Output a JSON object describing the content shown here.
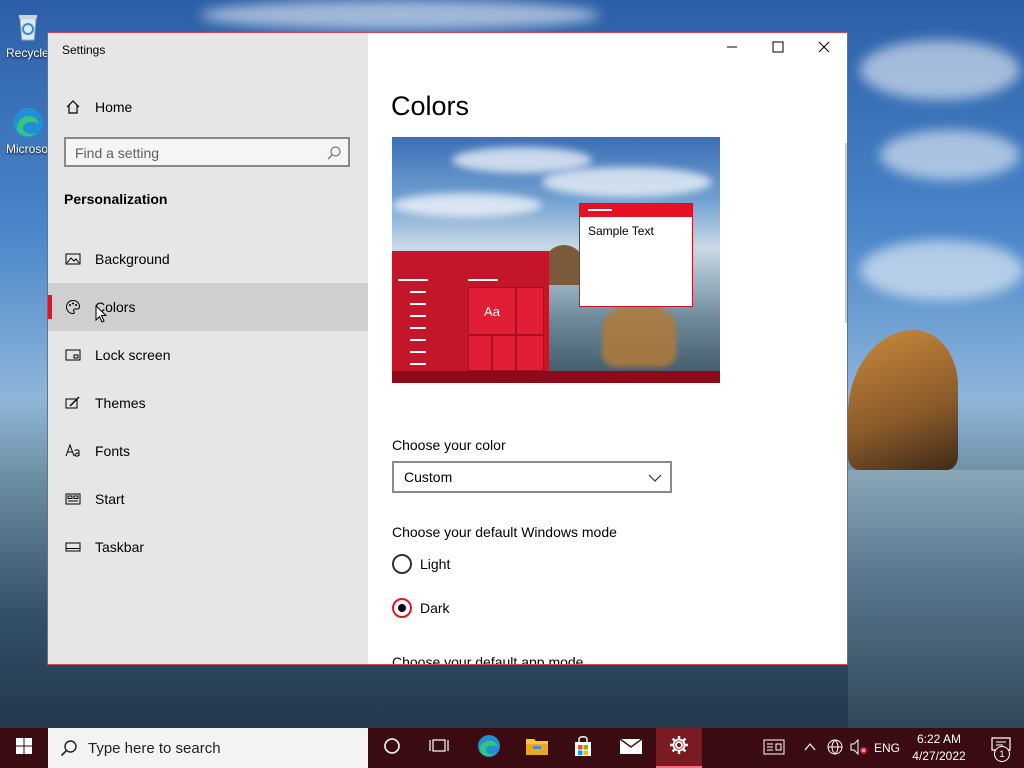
{
  "desktop": {
    "icons": [
      {
        "label": "Recycle Bin",
        "icon": "recycle-bin-icon"
      },
      {
        "label": "Microsoft Edge",
        "icon": "edge-icon"
      }
    ]
  },
  "window": {
    "title": "Settings",
    "controls": {
      "minimize": "minimize-icon",
      "maximize": "maximize-icon",
      "close": "close-icon"
    },
    "accent_color": "#e81123"
  },
  "nav": {
    "home_label": "Home",
    "search_placeholder": "Find a setting",
    "section_title": "Personalization",
    "items": [
      {
        "label": "Background",
        "icon": "picture-icon",
        "selected": false
      },
      {
        "label": "Colors",
        "icon": "palette-icon",
        "selected": true
      },
      {
        "label": "Lock screen",
        "icon": "lock-screen-icon",
        "selected": false
      },
      {
        "label": "Themes",
        "icon": "themes-icon",
        "selected": false
      },
      {
        "label": "Fonts",
        "icon": "fonts-icon",
        "selected": false
      },
      {
        "label": "Start",
        "icon": "start-icon",
        "selected": false
      },
      {
        "label": "Taskbar",
        "icon": "taskbar-icon",
        "selected": false
      }
    ]
  },
  "content": {
    "page_title": "Colors",
    "preview": {
      "tile_text": "Aa",
      "sample_text": "Sample Text"
    },
    "choose_color_label": "Choose your color",
    "color_select_value": "Custom",
    "windows_mode_label": "Choose your default Windows mode",
    "windows_mode_options": [
      {
        "label": "Light",
        "checked": false
      },
      {
        "label": "Dark",
        "checked": true
      }
    ],
    "app_mode_label": "Choose your default app mode"
  },
  "taskbar": {
    "search_placeholder": "Type here to search",
    "apps": [
      "cortana-icon",
      "task-view-icon",
      "edge-icon",
      "file-explorer-icon",
      "store-icon",
      "mail-icon",
      "settings-icon"
    ],
    "active_app": "settings-icon",
    "tray": {
      "language": "ENG",
      "time": "6:22 AM",
      "date": "4/27/2022",
      "notification_count": "1"
    }
  }
}
